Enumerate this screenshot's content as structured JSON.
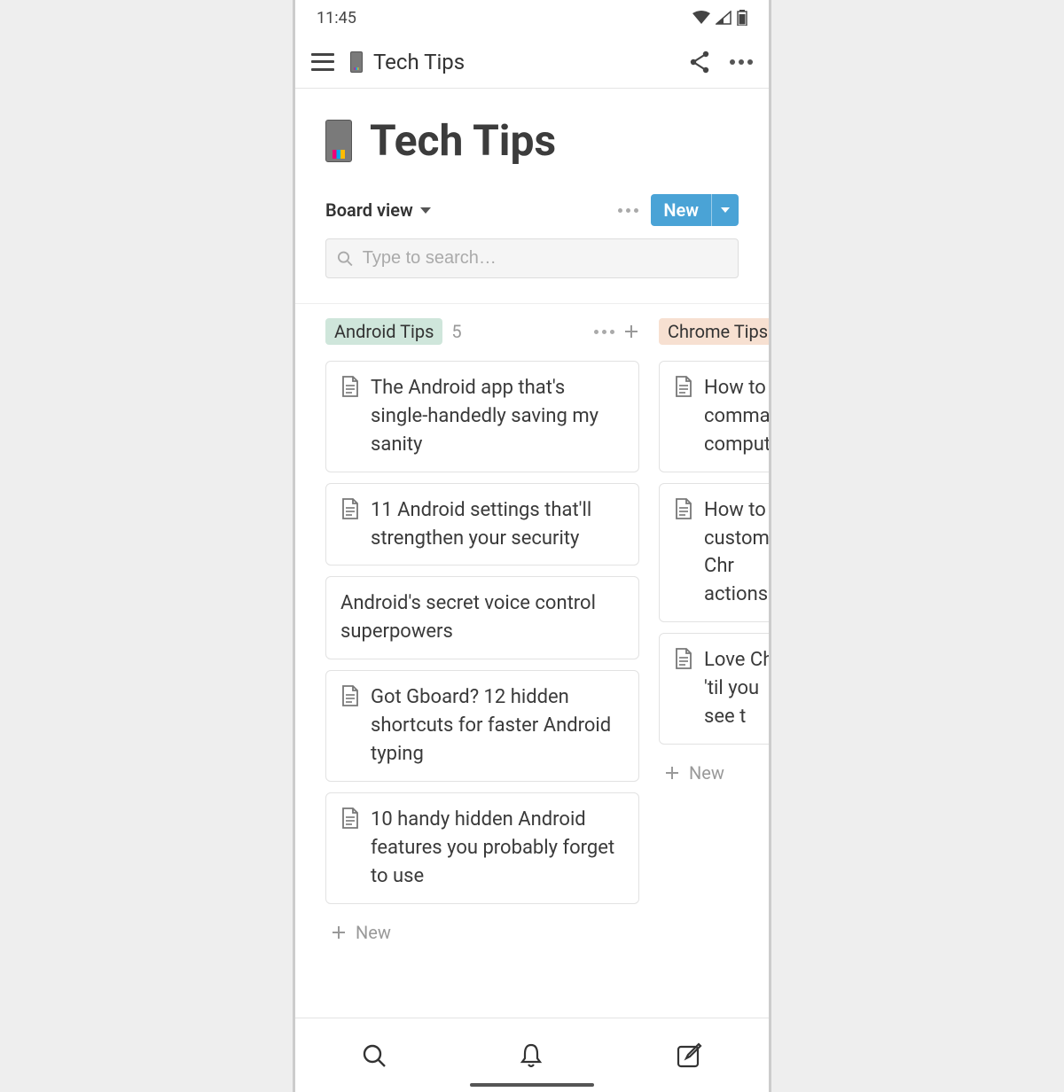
{
  "status": {
    "time": "11:45"
  },
  "appbar": {
    "title": "Tech Tips"
  },
  "page": {
    "title": "Tech Tips"
  },
  "toolbar": {
    "view_label": "Board view",
    "new_label": "New"
  },
  "search": {
    "placeholder": "Type to search…"
  },
  "columns": [
    {
      "tag": "Android Tips",
      "tag_color": "green",
      "count": "5",
      "cards": [
        {
          "title": "The Android app that's single-handedly saving my sanity",
          "icon": true
        },
        {
          "title": "11 Android settings that'll strengthen your security",
          "icon": true
        },
        {
          "title": "Android's secret voice control superpowers",
          "icon": false
        },
        {
          "title": "Got Gboard? 12 hidden shortcuts for faster Android typing",
          "icon": true
        },
        {
          "title": "10 handy hidden Android features you probably forget to use",
          "icon": true
        }
      ],
      "add_label": "New"
    },
    {
      "tag": "Chrome Tips",
      "tag_color": "orange",
      "count": "",
      "cards": [
        {
          "title": "How to access Chrome commands from any computer",
          "icon": true,
          "display": "How to a commands computer"
        },
        {
          "title": "How to create custom Chrome actions",
          "icon": true,
          "display": "How to c custom Chr actions"
        },
        {
          "title": "Love Chrome? Wait 'til you see this",
          "icon": true,
          "display": "Love Ch 'til you see t"
        }
      ],
      "add_label": "New"
    }
  ]
}
